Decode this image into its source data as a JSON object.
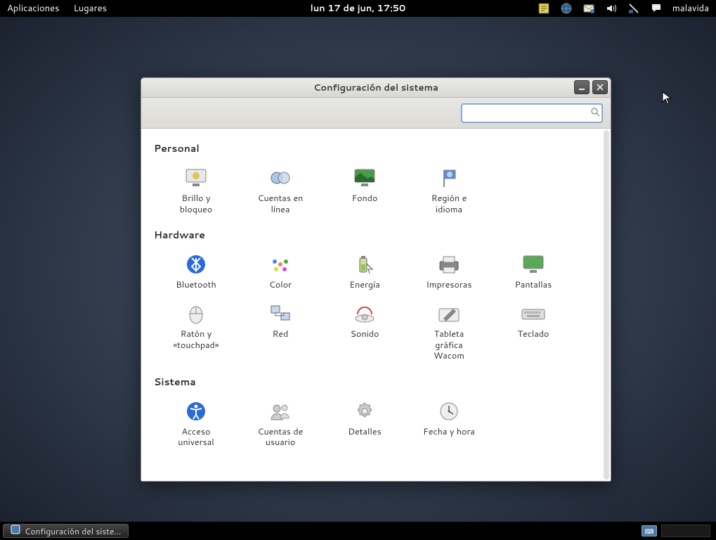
{
  "top_panel": {
    "apps": "Aplicaciones",
    "places": "Lugares",
    "clock": "lun 17 de jun, 17:50",
    "user": "malavida"
  },
  "bottom_panel": {
    "task": "Configuración del siste…"
  },
  "window": {
    "title": "Configuración del sistema",
    "search_placeholder": ""
  },
  "sections": {
    "personal": {
      "title": "Personal",
      "items": [
        {
          "id": "brightness-lock",
          "label": "Brillo y\nbloqueo"
        },
        {
          "id": "online-accounts",
          "label": "Cuentas en\nlínea"
        },
        {
          "id": "background",
          "label": "Fondo"
        },
        {
          "id": "region-language",
          "label": "Región e\nidioma"
        }
      ]
    },
    "hardware": {
      "title": "Hardware",
      "items": [
        {
          "id": "bluetooth",
          "label": "Bluetooth"
        },
        {
          "id": "color",
          "label": "Color"
        },
        {
          "id": "energy",
          "label": "Energía"
        },
        {
          "id": "printers",
          "label": "Impresoras"
        },
        {
          "id": "displays",
          "label": "Pantallas"
        },
        {
          "id": "mouse-touchpad",
          "label": "Ratón y\n«touchpad»"
        },
        {
          "id": "network",
          "label": "Red"
        },
        {
          "id": "sound",
          "label": "Sonido"
        },
        {
          "id": "wacom",
          "label": "Tableta\ngráfica\nWacom"
        },
        {
          "id": "keyboard",
          "label": "Teclado"
        }
      ]
    },
    "system": {
      "title": "Sistema",
      "items": [
        {
          "id": "universal-access",
          "label": "Acceso\nuniversal"
        },
        {
          "id": "user-accounts",
          "label": "Cuentas de\nusuario"
        },
        {
          "id": "details",
          "label": "Detalles"
        },
        {
          "id": "date-time",
          "label": "Fecha y hora"
        }
      ]
    }
  }
}
